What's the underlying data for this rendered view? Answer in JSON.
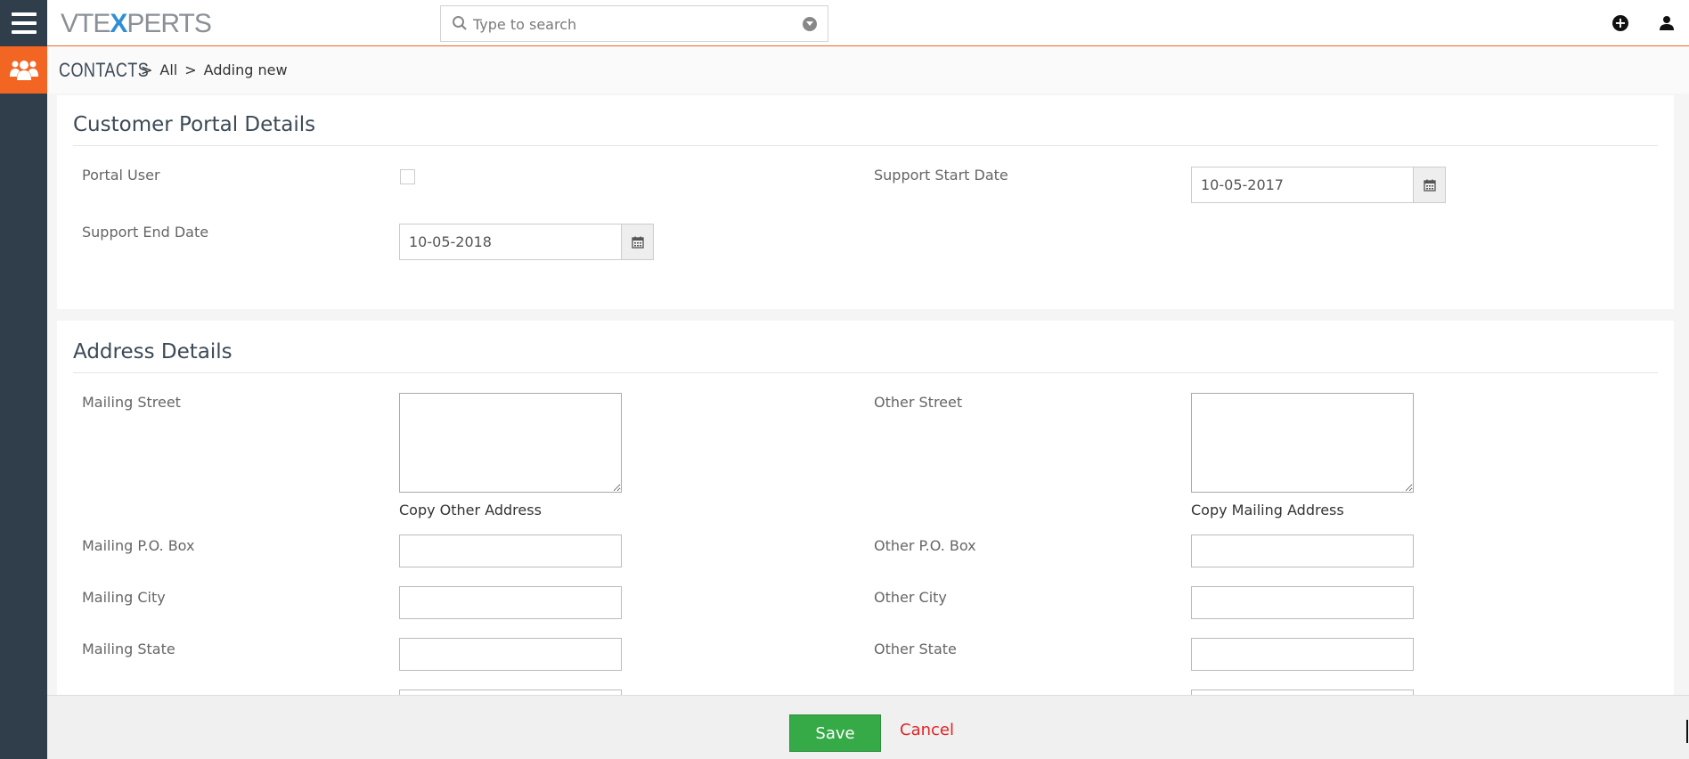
{
  "header": {
    "logo_left": "VTE",
    "logo_x": "X",
    "logo_right": "PERTS",
    "search_placeholder": "Type to search"
  },
  "breadcrumb": {
    "module": "CONTACTS",
    "sep": ">",
    "items": [
      "All",
      "Adding new"
    ]
  },
  "portal_block": {
    "title": "Customer Portal Details",
    "portal_user_label": "Portal User",
    "portal_user_checked": false,
    "support_start_label": "Support Start Date",
    "support_start_value": "10-05-2017",
    "support_end_label": "Support End Date",
    "support_end_value": "10-05-2018"
  },
  "address_block": {
    "title": "Address Details",
    "mailing_street_label": "Mailing Street",
    "other_street_label": "Other Street",
    "copy_other": "Copy Other Address",
    "copy_mailing": "Copy Mailing Address",
    "mailing_pobox_label": "Mailing P.O. Box",
    "other_pobox_label": "Other P.O. Box",
    "mailing_city_label": "Mailing City",
    "other_city_label": "Other City",
    "mailing_state_label": "Mailing State",
    "other_state_label": "Other State"
  },
  "footer": {
    "save_label": "Save",
    "cancel_label": "Cancel"
  },
  "colors": {
    "accent": "#f26522",
    "sidebar": "#2f3e4a",
    "save": "#35aa47",
    "cancel": "#e02424"
  }
}
